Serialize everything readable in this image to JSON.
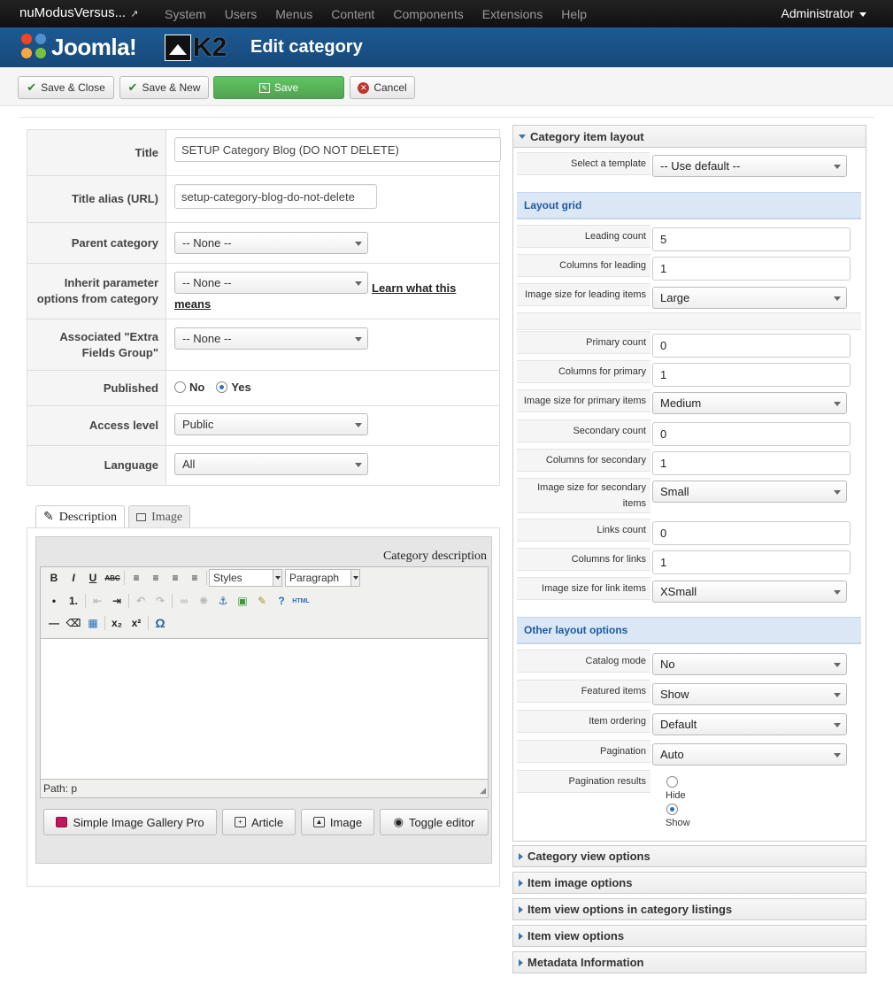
{
  "topnav": {
    "site_name": "nuModusVersus...",
    "menu": [
      "System",
      "Users",
      "Menus",
      "Content",
      "Components",
      "Extensions",
      "Help"
    ],
    "user": "Administrator"
  },
  "header": {
    "joomla_logo": "Joomla!",
    "k2_logo": "K2",
    "title": "Edit category"
  },
  "toolbar": {
    "save_close": "Save & Close",
    "save_new": "Save & New",
    "save": "Save",
    "cancel": "Cancel"
  },
  "form": {
    "title_label": "Title",
    "title_value": "SETUP Category Blog (DO NOT DELETE)",
    "alias_label": "Title alias (URL)",
    "alias_value": "setup-category-blog-do-not-delete",
    "parent_label": "Parent category",
    "parent_value": "-- None --",
    "inherit_label": "Inherit parameter options from category",
    "inherit_value": "-- None --",
    "learn_link_1": "Learn what this",
    "learn_link_2": "means",
    "extra_label": "Associated \"Extra Fields Group\"",
    "extra_value": "-- None --",
    "published_label": "Published",
    "published_no": "No",
    "published_yes": "Yes",
    "published_value": "Yes",
    "access_label": "Access level",
    "access_value": "Public",
    "language_label": "Language",
    "language_value": "All"
  },
  "editor": {
    "tab_description": "Description",
    "tab_image": "Image",
    "category_description": "Category description",
    "styles": "Styles",
    "paragraph": "Paragraph",
    "path": "Path: p",
    "btn_gallery": "Simple Image Gallery Pro",
    "btn_article": "Article",
    "btn_image": "Image",
    "btn_toggle": "Toggle editor"
  },
  "panel": {
    "heading": "Category item layout",
    "template_label": "Select a template",
    "template_value": "-- Use default --",
    "layout_grid": "Layout grid",
    "leading_count_label": "Leading count",
    "leading_count": "5",
    "columns_leading_label": "Columns for leading",
    "columns_leading": "1",
    "img_leading_label": "Image size for leading items",
    "img_leading": "Large",
    "primary_count_label": "Primary count",
    "primary_count": "0",
    "columns_primary_label": "Columns for primary",
    "columns_primary": "1",
    "img_primary_label": "Image size for primary items",
    "img_primary": "Medium",
    "secondary_count_label": "Secondary count",
    "secondary_count": "0",
    "columns_secondary_label": "Columns for secondary",
    "columns_secondary": "1",
    "img_secondary_label": "Image size for secondary items",
    "img_secondary": "Small",
    "links_count_label": "Links count",
    "links_count": "0",
    "columns_links_label": "Columns for links",
    "columns_links": "1",
    "img_links_label": "Image size for link items",
    "img_links": "XSmall",
    "other_layout": "Other layout options",
    "catalog_label": "Catalog mode",
    "catalog_value": "No",
    "featured_label": "Featured items",
    "featured_value": "Show",
    "ordering_label": "Item ordering",
    "ordering_value": "Default",
    "pagination_label": "Pagination",
    "pagination_value": "Auto",
    "pagination_results_label": "Pagination results",
    "pr_hide": "Hide",
    "pr_show": "Show",
    "pr_value": "Show"
  },
  "collapsed_sections": [
    "Category view options",
    "Item image options",
    "Item view options in category listings",
    "Item view options",
    "Metadata Information"
  ],
  "colors": {
    "topnav_bg": "#111111",
    "header_bg": "#1d5a93",
    "save_green": "#51a351",
    "section_blue": "#dbe7f5"
  }
}
